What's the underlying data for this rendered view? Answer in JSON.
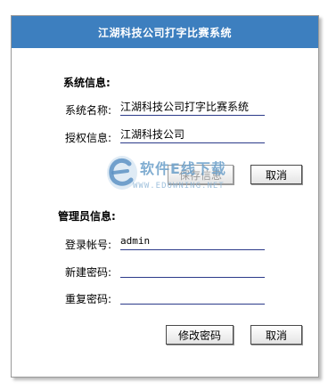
{
  "window": {
    "title": "江湖科技公司打字比赛系统"
  },
  "system_info": {
    "heading": "系统信息:",
    "name_label": "系统名称:",
    "name_value": "江湖科技公司打字比赛系统",
    "license_label": "授权信息:",
    "license_value": "江湖科技公司",
    "save_button": "保存信息",
    "cancel_button": "取消"
  },
  "admin_info": {
    "heading": "管理员信息:",
    "account_label": "登录帐号:",
    "account_value": "admin",
    "new_password_label": "新建密码:",
    "new_password_value": "",
    "repeat_password_label": "重复密码:",
    "repeat_password_value": "",
    "change_password_button": "修改密码",
    "cancel_button": "取消"
  },
  "watermark": {
    "icon": "e-logo-icon",
    "text_cn": "软件E线下载",
    "text_en": "WWW.EDOWNING.NET"
  },
  "colors": {
    "titlebar": "#3d7fbf",
    "field_underline": "#2b3a8a"
  }
}
